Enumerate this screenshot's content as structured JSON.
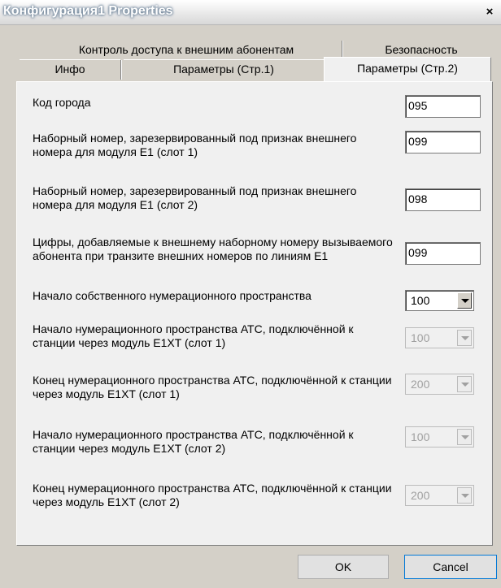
{
  "window": {
    "title": "Конфигурация1 Properties",
    "close_glyph": "×"
  },
  "tabs": {
    "row1": [
      "Контроль доступа к внешним абонентам",
      "Безопасность"
    ],
    "row2": [
      "Инфо",
      "Параметры (Стр.1)"
    ],
    "active": "Параметры (Стр.2)"
  },
  "fields": [
    {
      "label": "Код города",
      "value": "095",
      "type": "text"
    },
    {
      "label": "Наборный номер, зарезервированный под признак внешнего номера для модуля E1 (слот 1)",
      "value": "099",
      "type": "text"
    },
    {
      "label": "Наборный номер, зарезервированный под признак внешнего номера для модуля E1 (слот 2)",
      "value": "098",
      "type": "text"
    },
    {
      "label": "Цифры,  добавляемые к внешнему наборному номеру вызываемого абонента при транзите внешних номеров по линиям E1",
      "value": "099",
      "type": "text"
    },
    {
      "label": "Начало собственного нумерационного пространства",
      "value": "100",
      "type": "select",
      "enabled": true
    },
    {
      "label": "Начало нумерационного пространства АТС, подключённой к станции через модуль E1XT (слот 1)",
      "value": "100",
      "type": "select",
      "enabled": false
    },
    {
      "label": "Конец нумерационного пространства АТС, подключённой к станции через модуль E1XT (слот 1)",
      "value": "200",
      "type": "select",
      "enabled": false
    },
    {
      "label": "Начало нумерационного пространства АТС, подключённой к станции через модуль E1XT (слот 2)",
      "value": "100",
      "type": "select",
      "enabled": false
    },
    {
      "label": "Конец нумерационного пространства АТС, подключённой к станции через модуль E1XT (слот 2)",
      "value": "200",
      "type": "select",
      "enabled": false
    }
  ],
  "buttons": {
    "ok": "OK",
    "cancel": "Cancel"
  },
  "icons": {
    "close": "close-icon",
    "dropdown": "chevron-down-icon"
  }
}
